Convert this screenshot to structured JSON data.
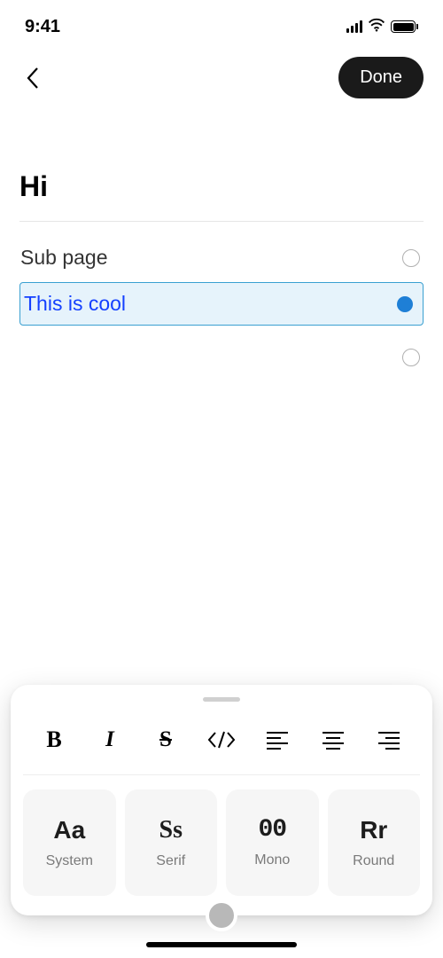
{
  "status": {
    "time": "9:41"
  },
  "nav": {
    "done_label": "Done"
  },
  "page": {
    "title": "Hi",
    "items": [
      {
        "label": "Sub page"
      },
      {
        "label": "This is cool"
      }
    ]
  },
  "fonts": [
    {
      "sample": "Aa",
      "name": "System"
    },
    {
      "sample": "Ss",
      "name": "Serif"
    },
    {
      "sample": "00",
      "name": "Mono"
    },
    {
      "sample": "Rr",
      "name": "Round"
    }
  ]
}
